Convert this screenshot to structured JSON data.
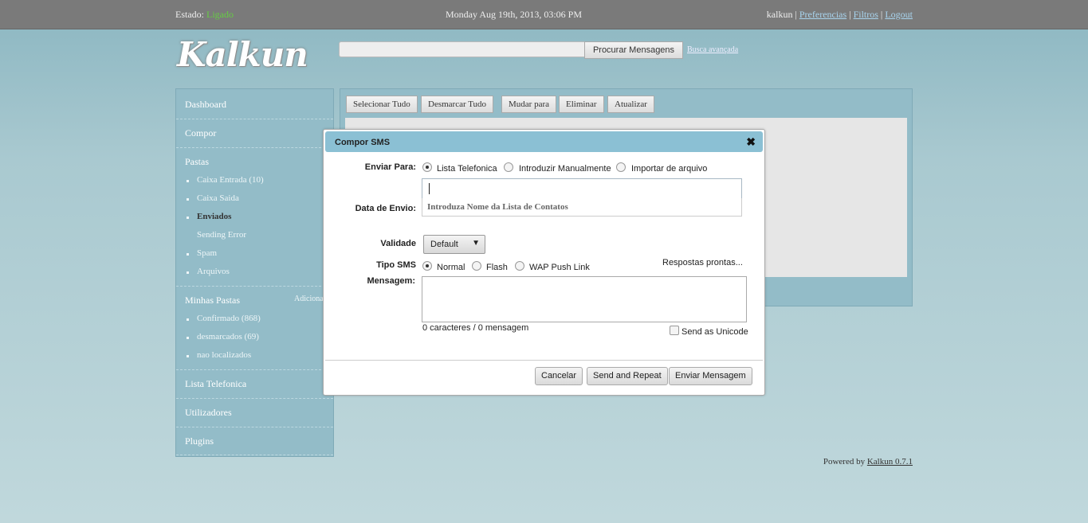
{
  "topbar": {
    "status_label": "Estado:",
    "status_value": "Ligado",
    "datetime": "Monday Aug 19th, 2013, 03:06 PM",
    "username": "kalkun",
    "separator": "|",
    "links": [
      "Preferencias",
      "Filtros",
      "Logout"
    ]
  },
  "logo": "Kalkun",
  "search": {
    "value": "",
    "button": "Procurar Mensagens",
    "advanced": "Busca avançada"
  },
  "sidebar": {
    "dashboard": "Dashboard",
    "compose": "Compor",
    "folders_title": "Pastas",
    "folders": [
      "Caixa Entrada (10)",
      "Caixa Saida",
      "Enviados",
      "Sending Error",
      "Spam",
      "Arquivos"
    ],
    "my_folders_title": "Minhas Pastas",
    "add_label": "Adicionar",
    "my_folders": [
      "Confirmado (868)",
      "desmarcados (69)",
      "nao localizados"
    ],
    "phonebook": "Lista Telefonica",
    "users": "Utilizadores",
    "plugins": "Plugins"
  },
  "toolbar": {
    "select_all": "Selecionar Tudo",
    "deselect_all": "Desmarcar Tudo",
    "move_to": "Mudar para",
    "delete": "Eliminar",
    "refresh": "Atualizar"
  },
  "dialog": {
    "title": "Compor SMS",
    "close": "✖",
    "send_to_label": "Enviar Para:",
    "send_to_options": [
      "Lista Telefonica",
      "Introduzir Manualmente",
      "Importar de arquivo"
    ],
    "send_to_selected": "Lista Telefonica",
    "to_input_value": "",
    "to_hint": "Introduza Nome da Lista de Contatos",
    "send_date_label": "Data de Envio:",
    "validity_label": "Validade",
    "validity_value": "Default",
    "sms_type_label": "Tipo SMS",
    "sms_type_options": [
      "Normal",
      "Flash",
      "WAP Push Link"
    ],
    "sms_type_selected": "Normal",
    "canned_responses": "Respostas prontas...",
    "message_label": "Mensagem:",
    "message_value": "",
    "counter": "0 caracteres / 0 mensagem",
    "unicode_label": "Send as Unicode",
    "unicode_checked": false,
    "buttons": {
      "cancel": "Cancelar",
      "send_repeat": "Send and Repeat",
      "send": "Enviar Mensagem"
    }
  },
  "footer": {
    "text": "Powered by",
    "link": "Kalkun 0.7.1"
  }
}
